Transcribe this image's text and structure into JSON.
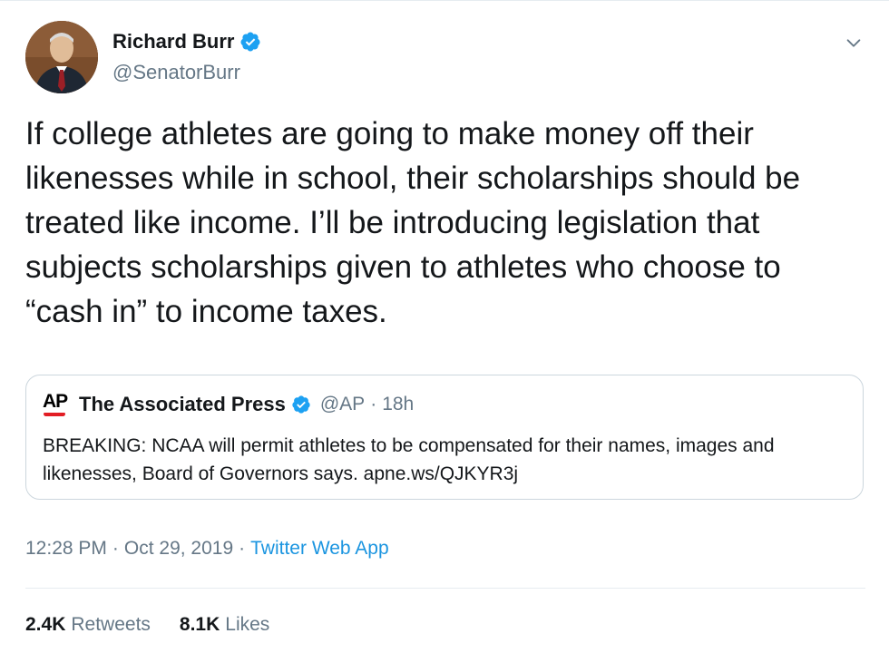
{
  "author": {
    "name": "Richard Burr",
    "handle": "@SenatorBurr",
    "verified": true
  },
  "tweet": {
    "text": "If college athletes are going to make money off their\nlikenesses while in school, their scholarships should be\ntreated like income. I’ll be introducing legislation that\nsubjects scholarships given to athletes who choose to\n“cash in” to income taxes."
  },
  "quoted_tweet": {
    "logo_text": "AP",
    "name": "The Associated Press",
    "handle": "@AP",
    "time": "18h",
    "separator": "·",
    "text": "BREAKING: NCAA will permit athletes to be compensated for their names, images and likenesses, Board of Governors says. apne.ws/QJKYR3j"
  },
  "meta": {
    "time": "12:28 PM",
    "date": "Oct 29, 2019",
    "separator": "·",
    "source": "Twitter Web App"
  },
  "stats": {
    "retweets_count": "2.4K",
    "retweets_label": "Retweets",
    "likes_count": "8.1K",
    "likes_label": "Likes"
  },
  "colors": {
    "accent": "#1b95e0",
    "verified": "#1da1f2",
    "secondary_text": "#657786",
    "ap_red": "#e21d24"
  },
  "icons": {
    "verified": "verified-badge-icon",
    "more": "chevron-down-icon"
  }
}
